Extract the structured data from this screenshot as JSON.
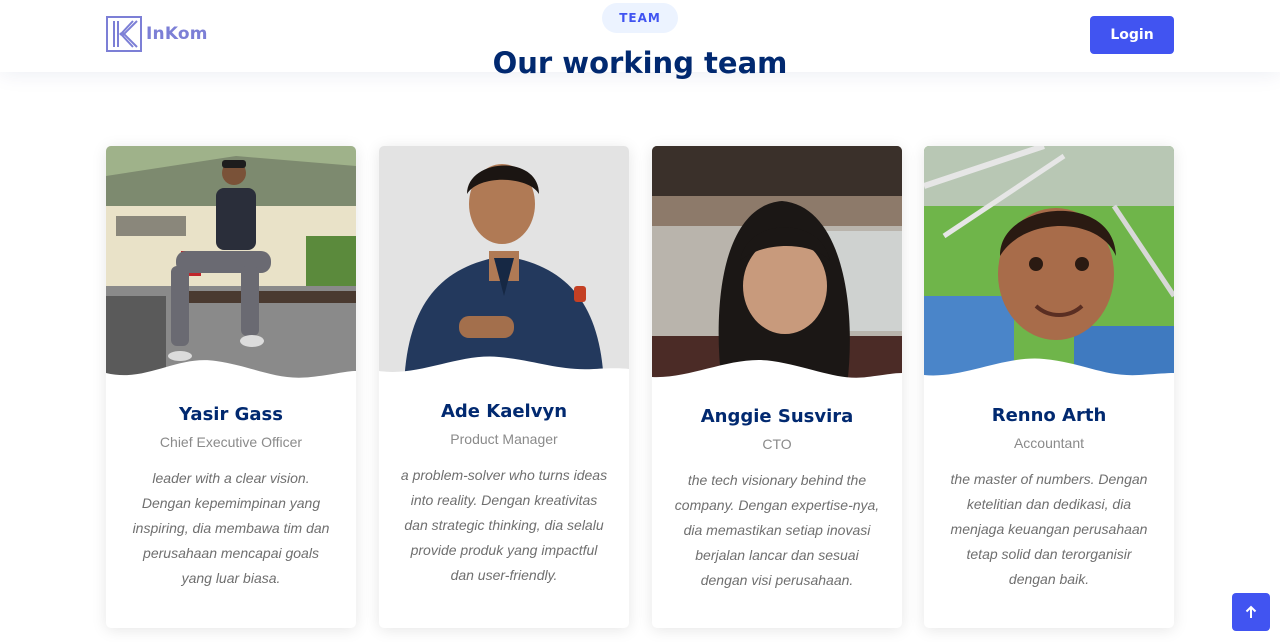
{
  "header": {
    "logo_text": "InKom",
    "login_label": "Login"
  },
  "section": {
    "tag": "TEAM",
    "title": "Our working team"
  },
  "team": [
    {
      "name": "Yasir Gass",
      "role": "Chief Executive Officer",
      "description": "leader with a clear vision. Dengan kepemimpinan yang inspiring, dia membawa tim dan perusahaan mencapai goals yang luar biasa."
    },
    {
      "name": "Ade Kaelvyn",
      "role": "Product Manager",
      "description": "a problem-solver who turns ideas into reality. Dengan kreativitas dan strategic thinking, dia selalu provide produk yang impactful dan user-friendly."
    },
    {
      "name": "Anggie Susvira",
      "role": "CTO",
      "description": "the tech visionary behind the company. Dengan expertise-nya, dia memastikan setiap inovasi berjalan lancar dan sesuai dengan visi perusahaan."
    },
    {
      "name": "Renno Arth",
      "role": "Accountant",
      "description": "the master of numbers. Dengan ketelitian dan dedikasi, dia menjaga keuangan perusahaan tetap solid dan terorganisir dengan baik."
    }
  ],
  "icons": {
    "logo": "inkom-logo-icon",
    "back_to_top": "arrow-up-icon"
  },
  "colors": {
    "accent": "#4154f1",
    "heading": "#012970",
    "logo": "#7c7fd6"
  }
}
